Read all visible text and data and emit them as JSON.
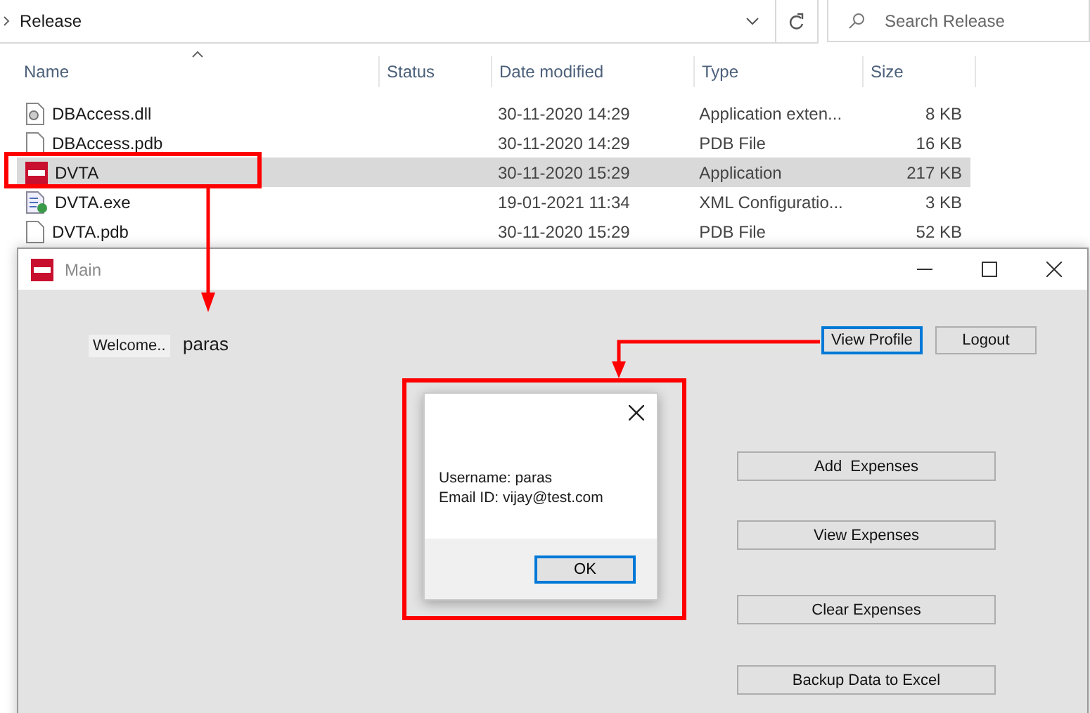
{
  "explorer": {
    "breadcrumb": "Release",
    "search": {
      "placeholder": "Search Release"
    },
    "columns": [
      {
        "label": "Name",
        "sorted": true
      },
      {
        "label": "Status"
      },
      {
        "label": "Date modified"
      },
      {
        "label": "Type"
      },
      {
        "label": "Size"
      }
    ],
    "rows": [
      {
        "name": "DBAccess.dll",
        "kind": "dll",
        "date": "30-11-2020 14:29",
        "type": "Application exten...",
        "size": "8 KB",
        "selected": false
      },
      {
        "name": "DBAccess.pdb",
        "kind": "file",
        "date": "30-11-2020 14:29",
        "type": "PDB File",
        "size": "16 KB",
        "selected": false
      },
      {
        "name": "DVTA",
        "kind": "app",
        "date": "30-11-2020 15:29",
        "type": "Application",
        "size": "217 KB",
        "selected": true
      },
      {
        "name": "DVTA.exe",
        "kind": "config",
        "date": "19-01-2021 11:34",
        "type": "XML Configuratio...",
        "size": "3 KB",
        "selected": false
      },
      {
        "name": "DVTA.pdb",
        "kind": "file",
        "date": "30-11-2020 15:29",
        "type": "PDB File",
        "size": "52 KB",
        "selected": false
      }
    ]
  },
  "main_window": {
    "title": "Main",
    "welcome_label": "Welcome..",
    "username": "paras",
    "top_buttons": [
      {
        "label": "View Profile",
        "focused": true
      },
      {
        "label": "Logout",
        "focused": false
      }
    ],
    "action_buttons": [
      "Add  Expenses",
      "View Expenses",
      "Clear Expenses",
      "Backup Data to Excel"
    ]
  },
  "dialog": {
    "lines": [
      "Username: paras",
      "Email ID: vijay@test.com"
    ],
    "button": "OK"
  }
}
